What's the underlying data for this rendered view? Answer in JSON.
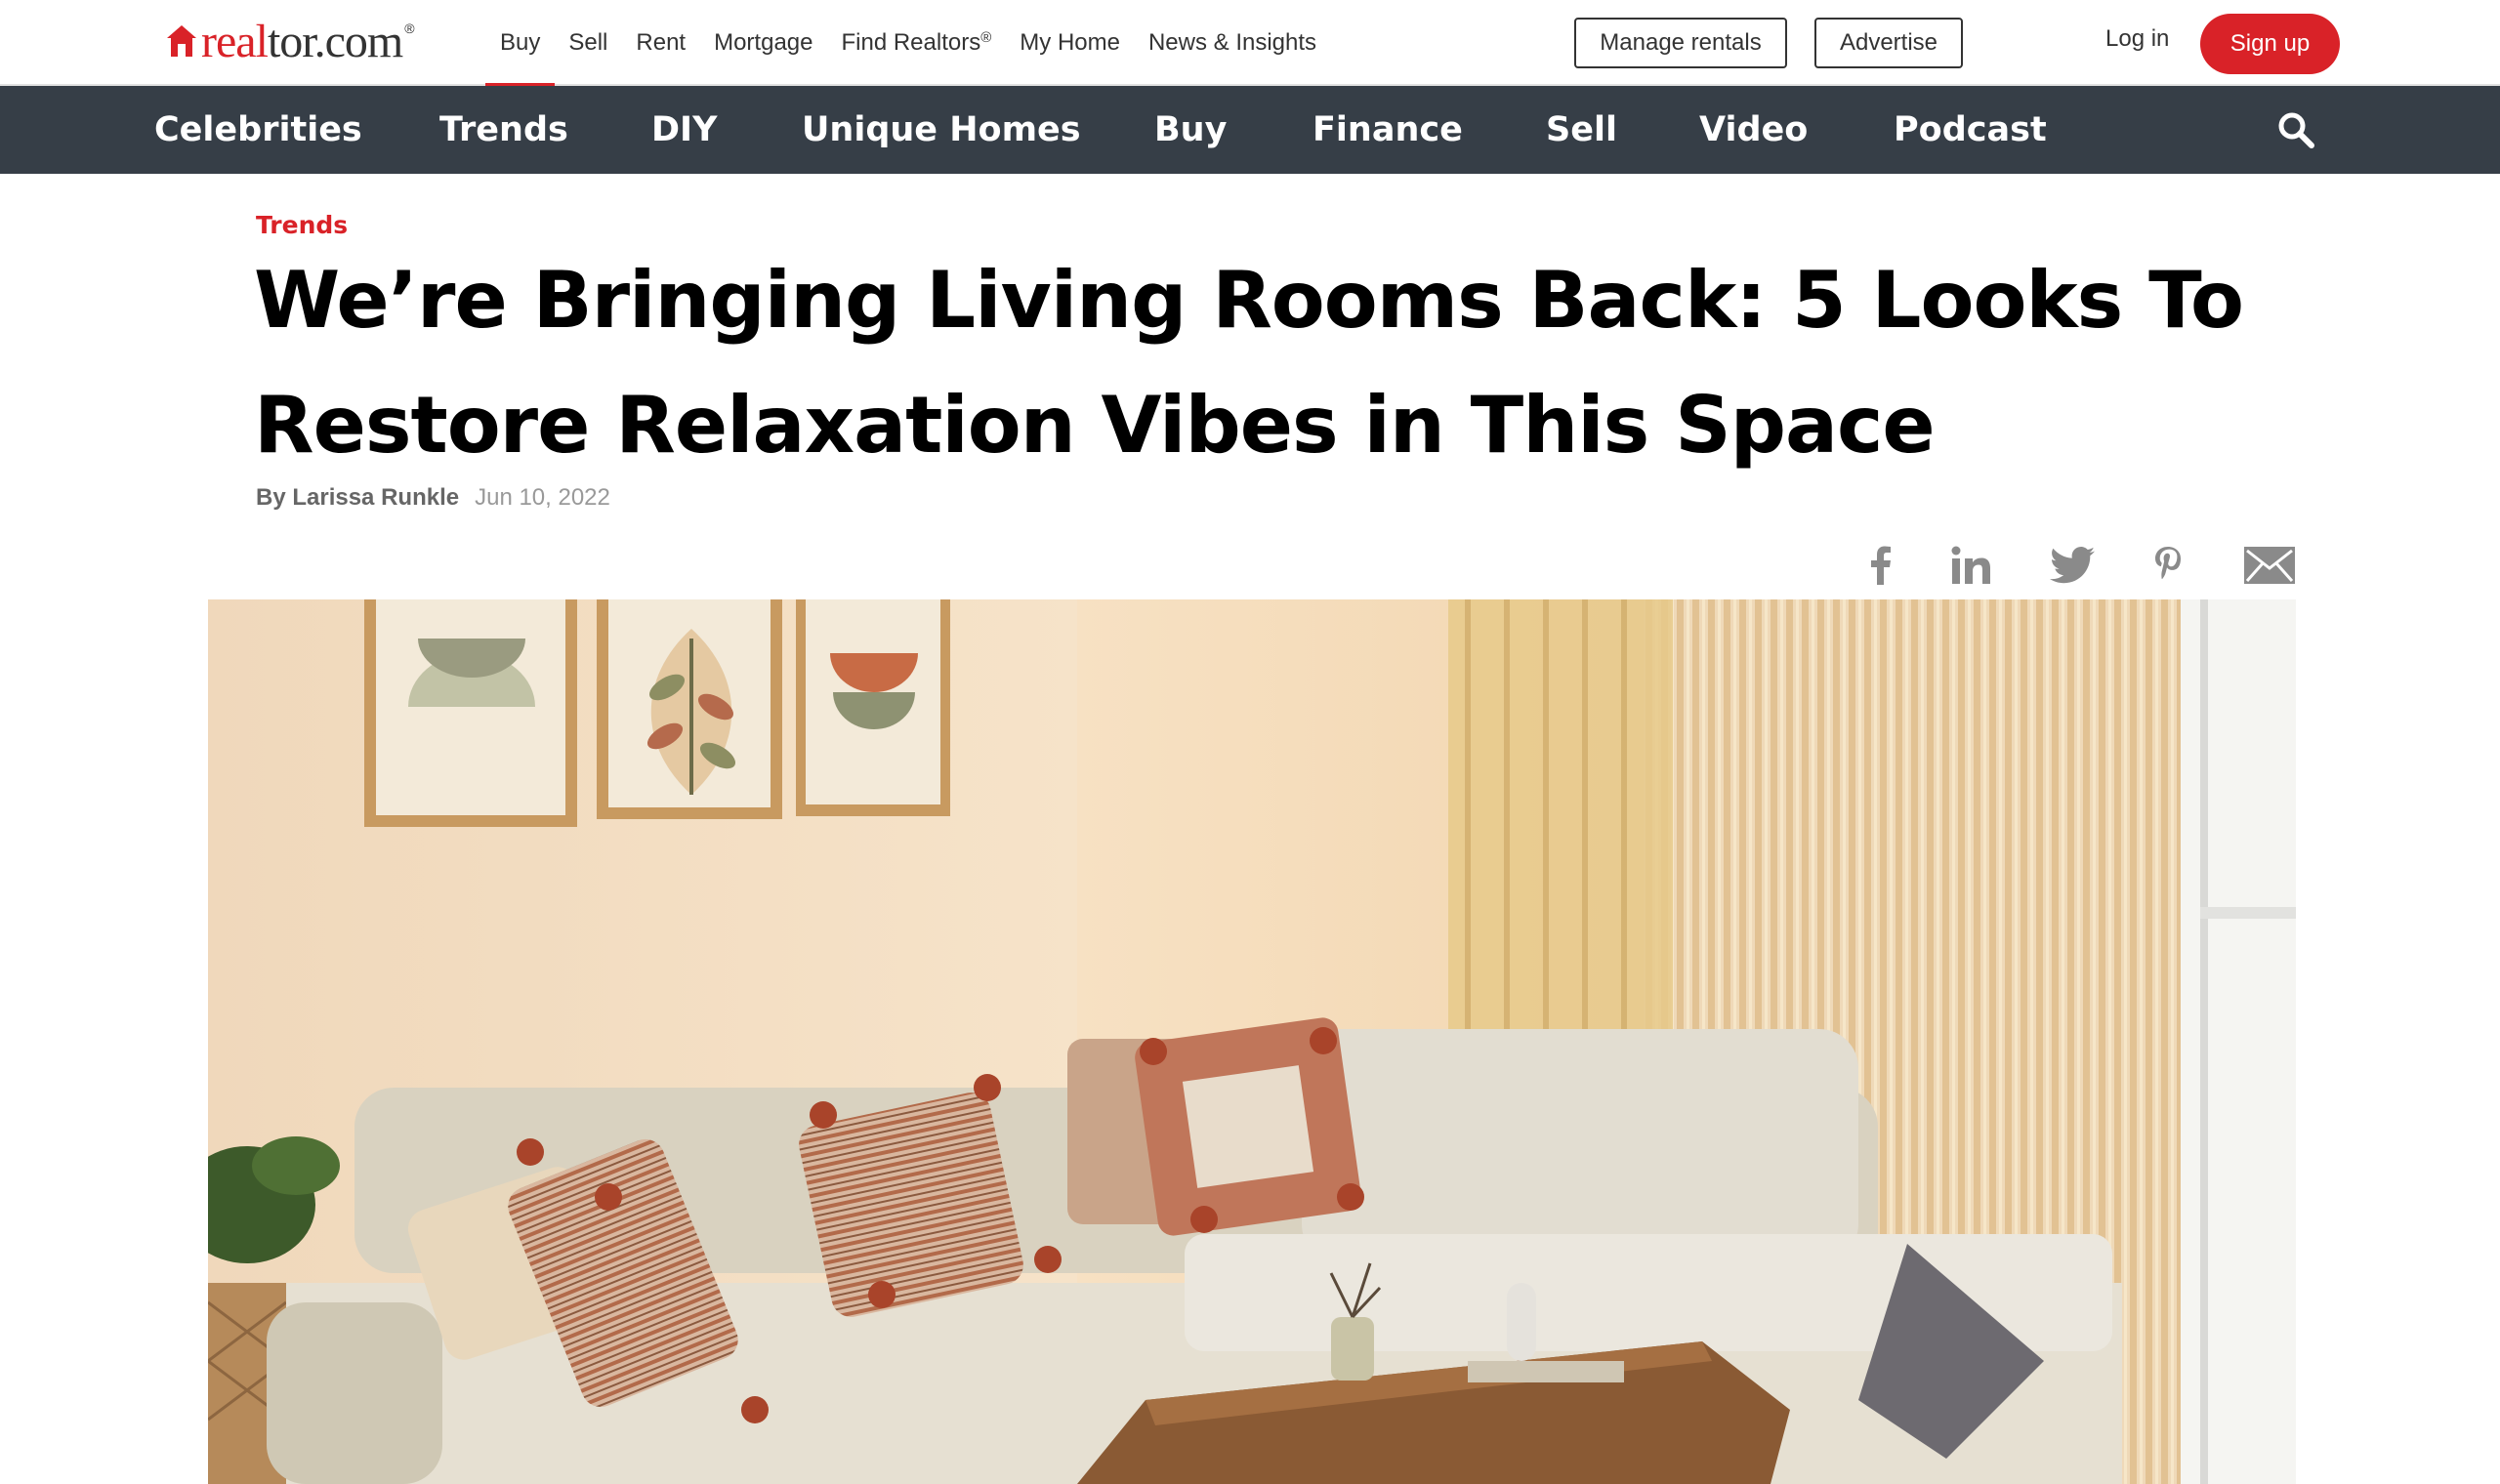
{
  "brand": {
    "logo_real": "real",
    "logo_rest": "tor.com",
    "logo_reg": "®",
    "accent": "#d92228"
  },
  "topnav": {
    "items": [
      "Buy",
      "Sell",
      "Rent",
      "Mortgage",
      "Find Realtors",
      "My Home",
      "News & Insights"
    ],
    "find_realtors_reg": "®",
    "active": "Buy"
  },
  "actions": {
    "manage_rentals": "Manage rentals",
    "advertise": "Advertise",
    "login": "Log in",
    "signup": "Sign up"
  },
  "categories": [
    "Celebrities",
    "Trends",
    "DIY",
    "Unique Homes",
    "Buy",
    "Finance",
    "Sell",
    "Video",
    "Podcast"
  ],
  "article": {
    "category": "Trends",
    "title": "We’re Bringing Living Rooms Back: 5 Looks To Restore Relaxation Vibes in This Space",
    "author": "By Larissa Runkle",
    "date": "Jun 10, 2022"
  },
  "share": [
    "facebook-icon",
    "linkedin-icon",
    "twitter-icon",
    "pinterest-icon",
    "email-icon"
  ],
  "colors": {
    "nav_bg": "#363e47",
    "accent": "#d92228",
    "icon_gray": "#8a8a8a"
  }
}
